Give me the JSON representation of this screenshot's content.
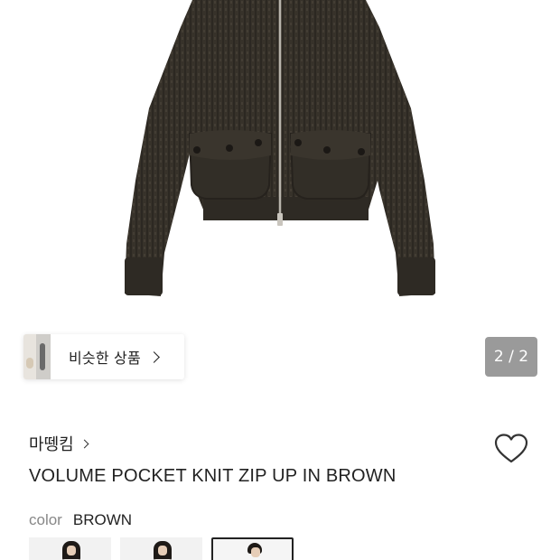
{
  "similar_products": {
    "label": "비슷한 상품"
  },
  "gallery": {
    "counter": "2 / 2"
  },
  "product": {
    "brand": "마뗑킴",
    "title": "VOLUME POCKET KNIT ZIP UP IN BROWN",
    "color_label": "color",
    "color_value": "BROWN"
  },
  "icons": {
    "brand_link": "chevron-right-icon",
    "similar_link": "chevron-right-icon",
    "wishlist": "heart-outline-icon"
  },
  "colors": {
    "knit": "#37322a",
    "counter_bg": "#787878"
  }
}
